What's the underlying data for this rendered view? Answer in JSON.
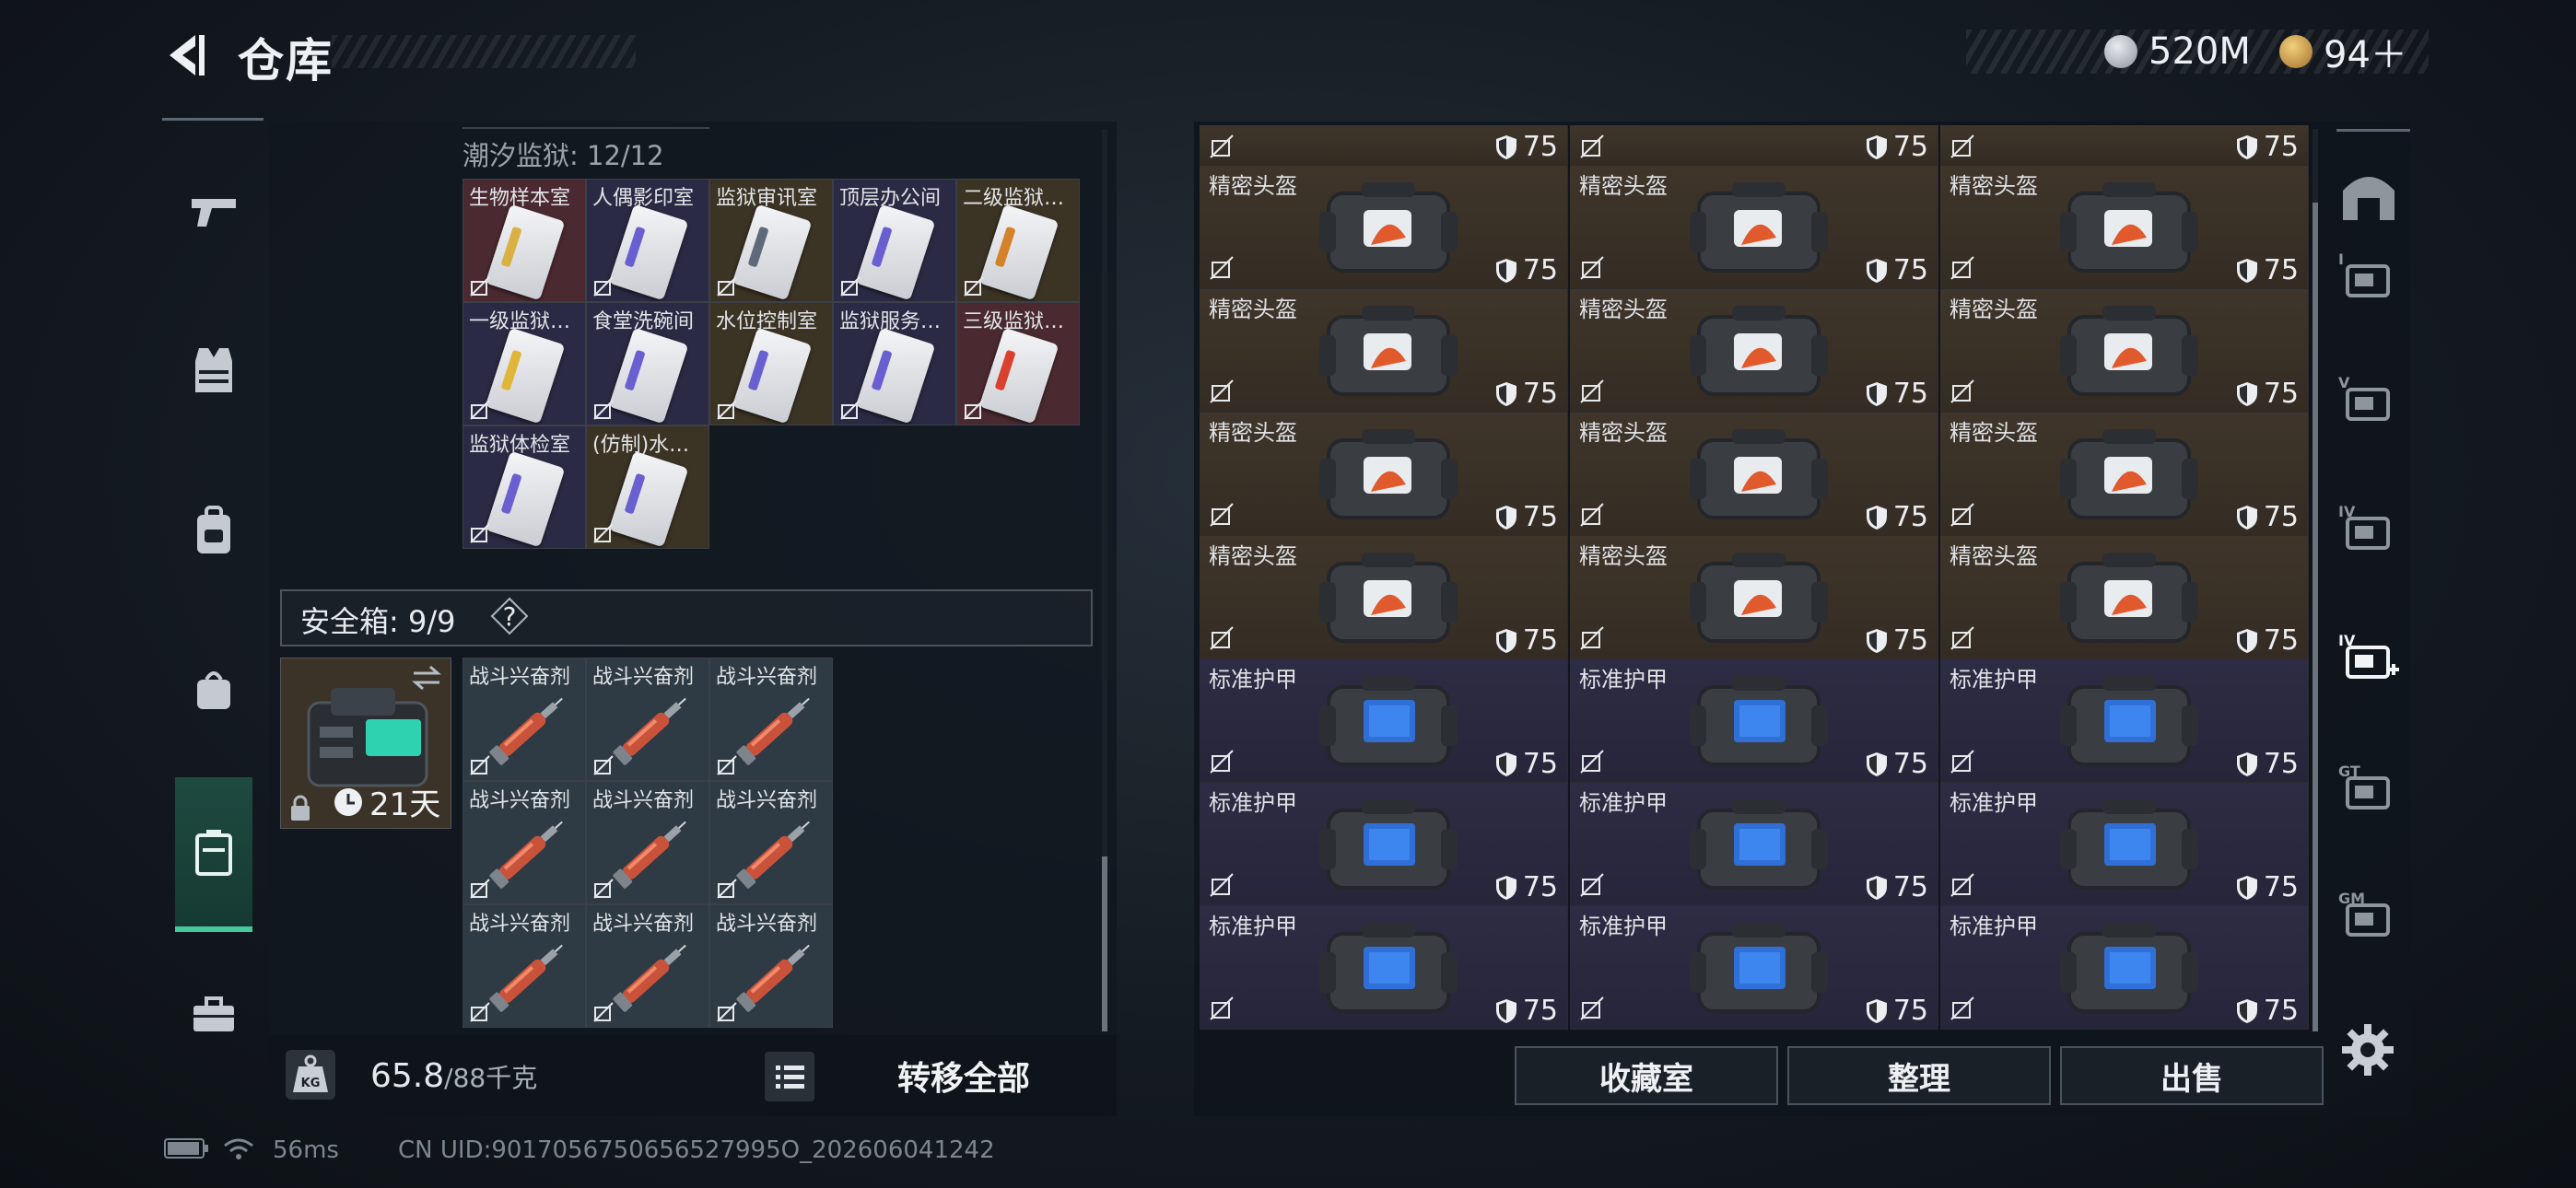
{
  "header": {
    "title": "仓库",
    "currency": [
      {
        "icon": "silver-coin-icon",
        "value": "520M",
        "color": "#c9ced4"
      },
      {
        "icon": "gold-triangle-icon",
        "value": "94＋",
        "color": "#d7a64a"
      }
    ]
  },
  "left_nav": [
    {
      "icon": "pistol-icon",
      "active": false
    },
    {
      "icon": "vest-icon",
      "active": false
    },
    {
      "icon": "backpack-icon",
      "active": false
    },
    {
      "icon": "pouch-icon",
      "active": false
    },
    {
      "icon": "storage-box-icon",
      "active": true
    },
    {
      "icon": "briefcase-icon",
      "active": false
    }
  ],
  "keycard_section": {
    "label": "潮汐监狱: 12/12",
    "cards": [
      {
        "label": "生物样本室",
        "bg": "#4a2a30",
        "strip": "#d9b044"
      },
      {
        "label": "人偶影印室",
        "bg": "#2b2a44",
        "strip": "#6a5fd0"
      },
      {
        "label": "监狱审讯室",
        "bg": "#3b3324",
        "strip": "#5c6a7a"
      },
      {
        "label": "顶层办公间",
        "bg": "#2b2a44",
        "strip": "#6a5fd0"
      },
      {
        "label": "二级监狱…",
        "bg": "#3b3324",
        "strip": "#d3822a"
      },
      {
        "label": "一级监狱…",
        "bg": "#2b2a44",
        "strip": "#e0b63a"
      },
      {
        "label": "食堂洗碗间",
        "bg": "#2b2a44",
        "strip": "#6a5fd0"
      },
      {
        "label": "水位控制室",
        "bg": "#3b3324",
        "strip": "#6a5fd0"
      },
      {
        "label": "监狱服务…",
        "bg": "#2b2a44",
        "strip": "#6a5fd0"
      },
      {
        "label": "三级监狱…",
        "bg": "#4a2a30",
        "strip": "#d9412e"
      },
      {
        "label": "监狱体检室",
        "bg": "#2b2a44",
        "strip": "#6a5fd0"
      },
      {
        "label": "(仿制)水…",
        "bg": "#3b3324",
        "strip": "#6a5fd0"
      }
    ]
  },
  "safe_box": {
    "label": "安全箱: 9/9",
    "help": "?",
    "duration": "21天",
    "items": [
      "战斗兴奋剂",
      "战斗兴奋剂",
      "战斗兴奋剂",
      "战斗兴奋剂",
      "战斗兴奋剂",
      "战斗兴奋剂",
      "战斗兴奋剂",
      "战斗兴奋剂",
      "战斗兴奋剂"
    ]
  },
  "weight": {
    "current": "65.8",
    "max": "/88千克"
  },
  "transfer_all": "转移全部",
  "stash": {
    "top_partial_durability": [
      "75",
      "75",
      "75"
    ],
    "rows": [
      {
        "kind": "helm",
        "items": [
          {
            "label": "精密头盔",
            "durability": "75"
          },
          {
            "label": "精密头盔",
            "durability": "75"
          },
          {
            "label": "精密头盔",
            "durability": "75"
          }
        ]
      },
      {
        "kind": "helm",
        "items": [
          {
            "label": "精密头盔",
            "durability": "75"
          },
          {
            "label": "精密头盔",
            "durability": "75"
          },
          {
            "label": "精密头盔",
            "durability": "75"
          }
        ]
      },
      {
        "kind": "helm",
        "items": [
          {
            "label": "精密头盔",
            "durability": "75"
          },
          {
            "label": "精密头盔",
            "durability": "75"
          },
          {
            "label": "精密头盔",
            "durability": "75"
          }
        ]
      },
      {
        "kind": "helm",
        "items": [
          {
            "label": "精密头盔",
            "durability": "75"
          },
          {
            "label": "精密头盔",
            "durability": "75"
          },
          {
            "label": "精密头盔",
            "durability": "75"
          }
        ]
      },
      {
        "kind": "armor",
        "items": [
          {
            "label": "标准护甲",
            "durability": "75"
          },
          {
            "label": "标准护甲",
            "durability": "75"
          },
          {
            "label": "标准护甲",
            "durability": "75"
          }
        ]
      },
      {
        "kind": "armor",
        "items": [
          {
            "label": "标准护甲",
            "durability": "75"
          },
          {
            "label": "标准护甲",
            "durability": "75"
          },
          {
            "label": "标准护甲",
            "durability": "75"
          }
        ]
      },
      {
        "kind": "armor",
        "items": [
          {
            "label": "标准护甲",
            "durability": "75"
          },
          {
            "label": "标准护甲",
            "durability": "75"
          },
          {
            "label": "标准护甲",
            "durability": "75"
          }
        ]
      }
    ]
  },
  "actions": {
    "collection": "收藏室",
    "sort": "整理",
    "sell": "出售"
  },
  "right_tabs": [
    {
      "icon": "stash-home-icon",
      "active": false
    },
    {
      "icon": "stash-page-i-icon",
      "active": false
    },
    {
      "icon": "stash-page-v-icon",
      "active": false
    },
    {
      "icon": "stash-page-iv-icon",
      "active": false
    },
    {
      "icon": "stash-page-iv-add-icon",
      "active": true
    },
    {
      "icon": "stash-page-gt-icon",
      "active": false
    },
    {
      "icon": "stash-page-gm-icon",
      "active": false
    }
  ],
  "status_bar": {
    "ping": "56ms",
    "uid": "CN UID:9017056750656527995O_202606041242"
  }
}
